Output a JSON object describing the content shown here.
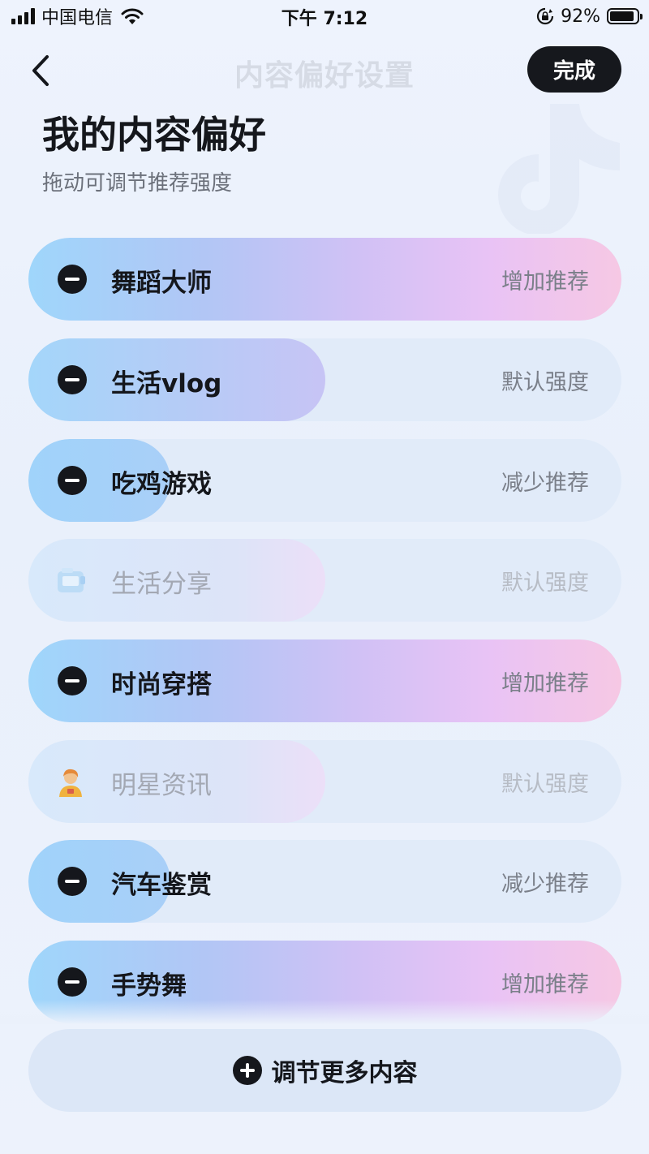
{
  "status_bar": {
    "carrier": "中国电信",
    "time": "下午 7:12",
    "battery_percent": "92%",
    "battery_level": 0.92,
    "icons": [
      "signal-icon",
      "wifi-icon",
      "rotation-lock-icon",
      "battery-icon"
    ]
  },
  "nav": {
    "title": "内容偏好设置",
    "done_label": "完成",
    "back_icon": "chevron-left-icon"
  },
  "header": {
    "title": "我的内容偏好",
    "subtitle": "拖动可调节推荐强度"
  },
  "colors": {
    "accent_dark": "#16181d",
    "row_track": "#e1ebf9",
    "fill_blue": "#9fd6fb",
    "fill_pink": "#f6c8e4"
  },
  "preferences": [
    {
      "name": "舞蹈大师",
      "level_label": "增加推荐",
      "level": 1.0,
      "state": "increase",
      "icon": "remove-icon",
      "enabled": true
    },
    {
      "name": "生活vlog",
      "level_label": "默认强度",
      "level": 0.5,
      "state": "default",
      "icon": "remove-icon",
      "enabled": true
    },
    {
      "name": "吃鸡游戏",
      "level_label": "减少推荐",
      "level": 0.24,
      "state": "decrease",
      "icon": "remove-icon",
      "enabled": true
    },
    {
      "name": "生活分享",
      "level_label": "默认强度",
      "level": 0.5,
      "state": "default",
      "icon": "camera-card-icon",
      "enabled": false
    },
    {
      "name": "时尚穿搭",
      "level_label": "增加推荐",
      "level": 1.0,
      "state": "increase",
      "icon": "remove-icon",
      "enabled": true
    },
    {
      "name": "明星资讯",
      "level_label": "默认强度",
      "level": 0.5,
      "state": "default",
      "icon": "star-person-icon",
      "enabled": false
    },
    {
      "name": "汽车鉴赏",
      "level_label": "减少推荐",
      "level": 0.24,
      "state": "decrease",
      "icon": "remove-icon",
      "enabled": true
    },
    {
      "name": "手势舞",
      "level_label": "增加推荐",
      "level": 1.0,
      "state": "increase",
      "icon": "remove-icon",
      "enabled": true
    }
  ],
  "more_button": {
    "label": "调节更多内容",
    "icon": "plus-circle-icon"
  }
}
